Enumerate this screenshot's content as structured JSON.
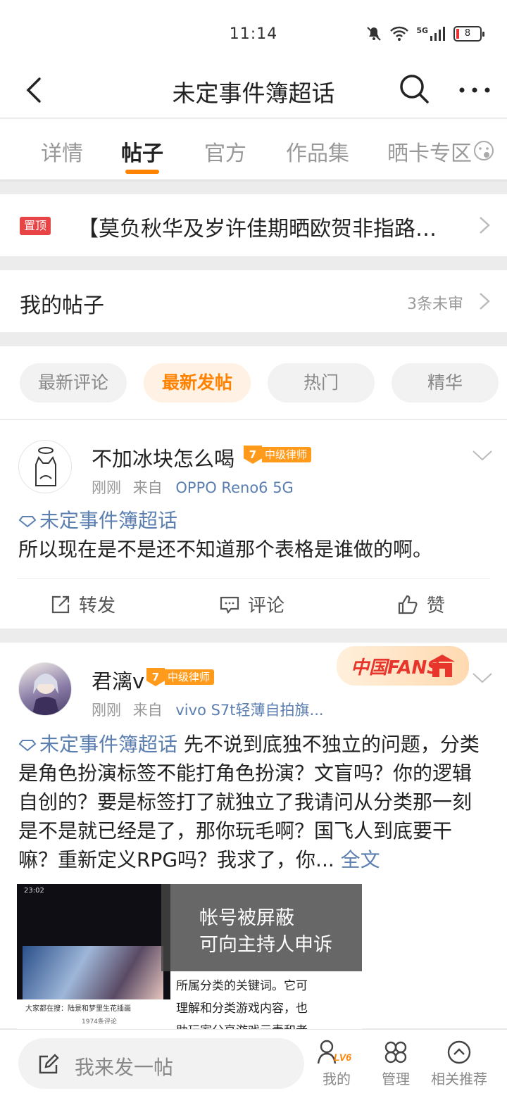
{
  "status": {
    "time": "11:14",
    "battery": "8",
    "network": "5G"
  },
  "header": {
    "title": "未定事件簿超话"
  },
  "tabs": [
    {
      "label": "详情"
    },
    {
      "label": "帖子"
    },
    {
      "label": "官方"
    },
    {
      "label": "作品集"
    },
    {
      "label": "晒卡专区"
    }
  ],
  "pinned": {
    "badge": "置顶",
    "text": "【莫负秋华及岁许佳期晒欧贺非指路…"
  },
  "my_posts": {
    "label": "我的帖子",
    "unread": "3条未审"
  },
  "filters": [
    {
      "label": "最新评论"
    },
    {
      "label": "最新发帖"
    },
    {
      "label": "热门"
    },
    {
      "label": "精华"
    }
  ],
  "posts": [
    {
      "username": "不加冰块怎么喝",
      "level": "7",
      "level_title": "中级律师",
      "time": "刚刚",
      "from": "来自",
      "device": "OPPO Reno6 5G",
      "topic": "未定事件簿超话",
      "text": "所以现在是不是还不知道那个表格是谁做的啊。",
      "actions": {
        "repost": "转发",
        "comment": "评论",
        "like": "赞"
      }
    },
    {
      "username": "君漓v",
      "level": "7",
      "level_title": "中级律师",
      "time": "刚刚",
      "from": "来自",
      "device": "vivo S7t轻薄自拍旗...",
      "topic": "未定事件簿超话",
      "text": "先不说到底独不独立的问题，分类是角色扮演标签不能打角色扮演？文盲吗？你的逻辑自创的？要是标签打了就独立了我请问从分类那一刻是不是就已经是了，那你玩毛啊？国飞人到底要干嘛？重新定义RPG吗？我求了，你...",
      "full_label": "全文",
      "badge": "中国FANS",
      "image": {
        "overlay_line1": "帐号被屏蔽",
        "overlay_line2": "可向主持人申诉",
        "status_time": "23:02",
        "caption_left": "大家都在搜：陆景和梦里生花插画",
        "caption_sub": "1974条评论",
        "lines": [
          "所属分类的关键词。它可",
          "理解和分类游戏内容，也",
          "助玩家分享游戏元素和者"
        ]
      }
    }
  ],
  "bottom": {
    "compose": "我来发一帖",
    "nav": [
      {
        "label": "我的",
        "badge": "LV6"
      },
      {
        "label": "管理"
      },
      {
        "label": "相关推荐"
      }
    ]
  },
  "colors": {
    "accent": "#ff8200",
    "link": "#5b7fb0",
    "pin": "#e84446",
    "level": "#ff9a1a"
  }
}
